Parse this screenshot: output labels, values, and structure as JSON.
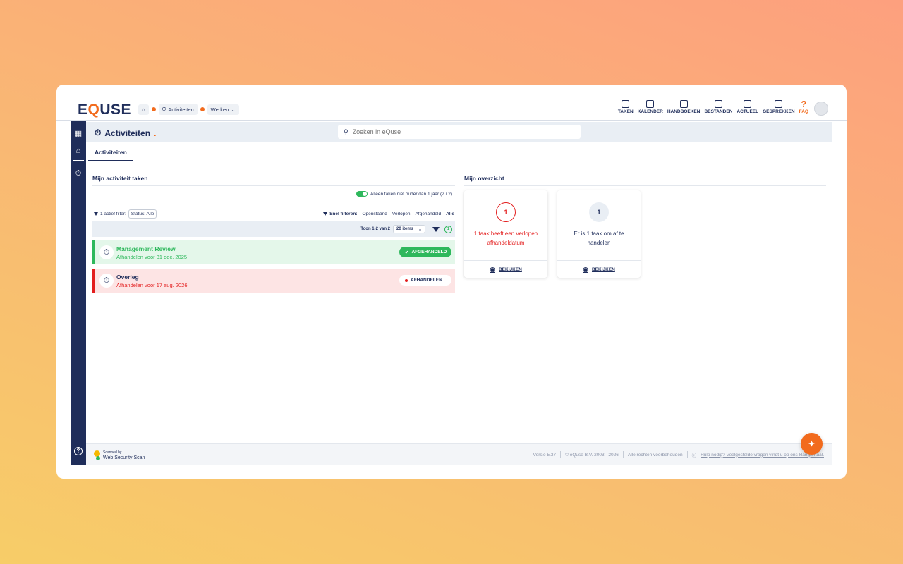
{
  "app": {
    "logo_left": "E",
    "logo_q": "Q",
    "logo_right": "USE"
  },
  "breadcrumb": {
    "item1": "Activiteiten",
    "item2": "Werken"
  },
  "nav": [
    {
      "label": "TAKEN",
      "icon": "clipboard-icon"
    },
    {
      "label": "KALENDER",
      "icon": "calendar-icon"
    },
    {
      "label": "HANDBOEKEN",
      "icon": "book-icon"
    },
    {
      "label": "BESTANDEN",
      "icon": "archive-icon"
    },
    {
      "label": "ACTUEEL",
      "icon": "news-icon"
    },
    {
      "label": "GESPREKKEN",
      "icon": "chat-icon"
    },
    {
      "label": "FAQ",
      "icon": "question-icon"
    }
  ],
  "header": {
    "title": "Activiteiten",
    "search_placeholder": "Zoeken in eQuse"
  },
  "tabs": [
    {
      "label": "Activiteiten"
    }
  ],
  "left": {
    "title": "Mijn activiteit taken",
    "toggle_label": "Alleen taken niet ouder dan 1 jaar (2 / 2)",
    "filter_count": "1 actief filter:",
    "filter_chip": "Status: Alle",
    "quick_label": "Snel filteren:",
    "quick": [
      "Openstaand",
      "Verlopen",
      "Afgehandeld",
      "Alle"
    ],
    "pager_text": "Toon 1-2 van 2",
    "pager_select": "20 items",
    "filter_badge": "1"
  },
  "tasks": [
    {
      "title": "Management Review",
      "sub": "Afhandelen voor 31 dec. 2025",
      "status": "AFGEHANDELD"
    },
    {
      "title": "Overleg",
      "sub": "Afhandelen voor 17 aug. 2026",
      "status": "AFHANDELEN"
    }
  ],
  "right": {
    "title": "Mijn overzicht",
    "cards": [
      {
        "number": "1",
        "text": "1 taak heeft een verlopen afhandeldatum",
        "action": "BEKIJKEN"
      },
      {
        "number": "1",
        "text": "Er is 1 taak om af te handelen",
        "action": "BEKIJKEN"
      }
    ]
  },
  "footer": {
    "scan_line1": "Scanned by",
    "scan_line2": "Web Security Scan",
    "version": "Versie 5.37",
    "copyright": "© eQuse B.V. 2003 - 2026",
    "rights": "Alle rechten voorbehouden",
    "help": "Hulp nodig? Veelgestelde vragen vindt u op ons klantportaal."
  },
  "colors": {
    "navy": "#1f2d5a",
    "accent": "#f26b1d",
    "green": "#2eb85c",
    "red": "#e31d1d"
  }
}
